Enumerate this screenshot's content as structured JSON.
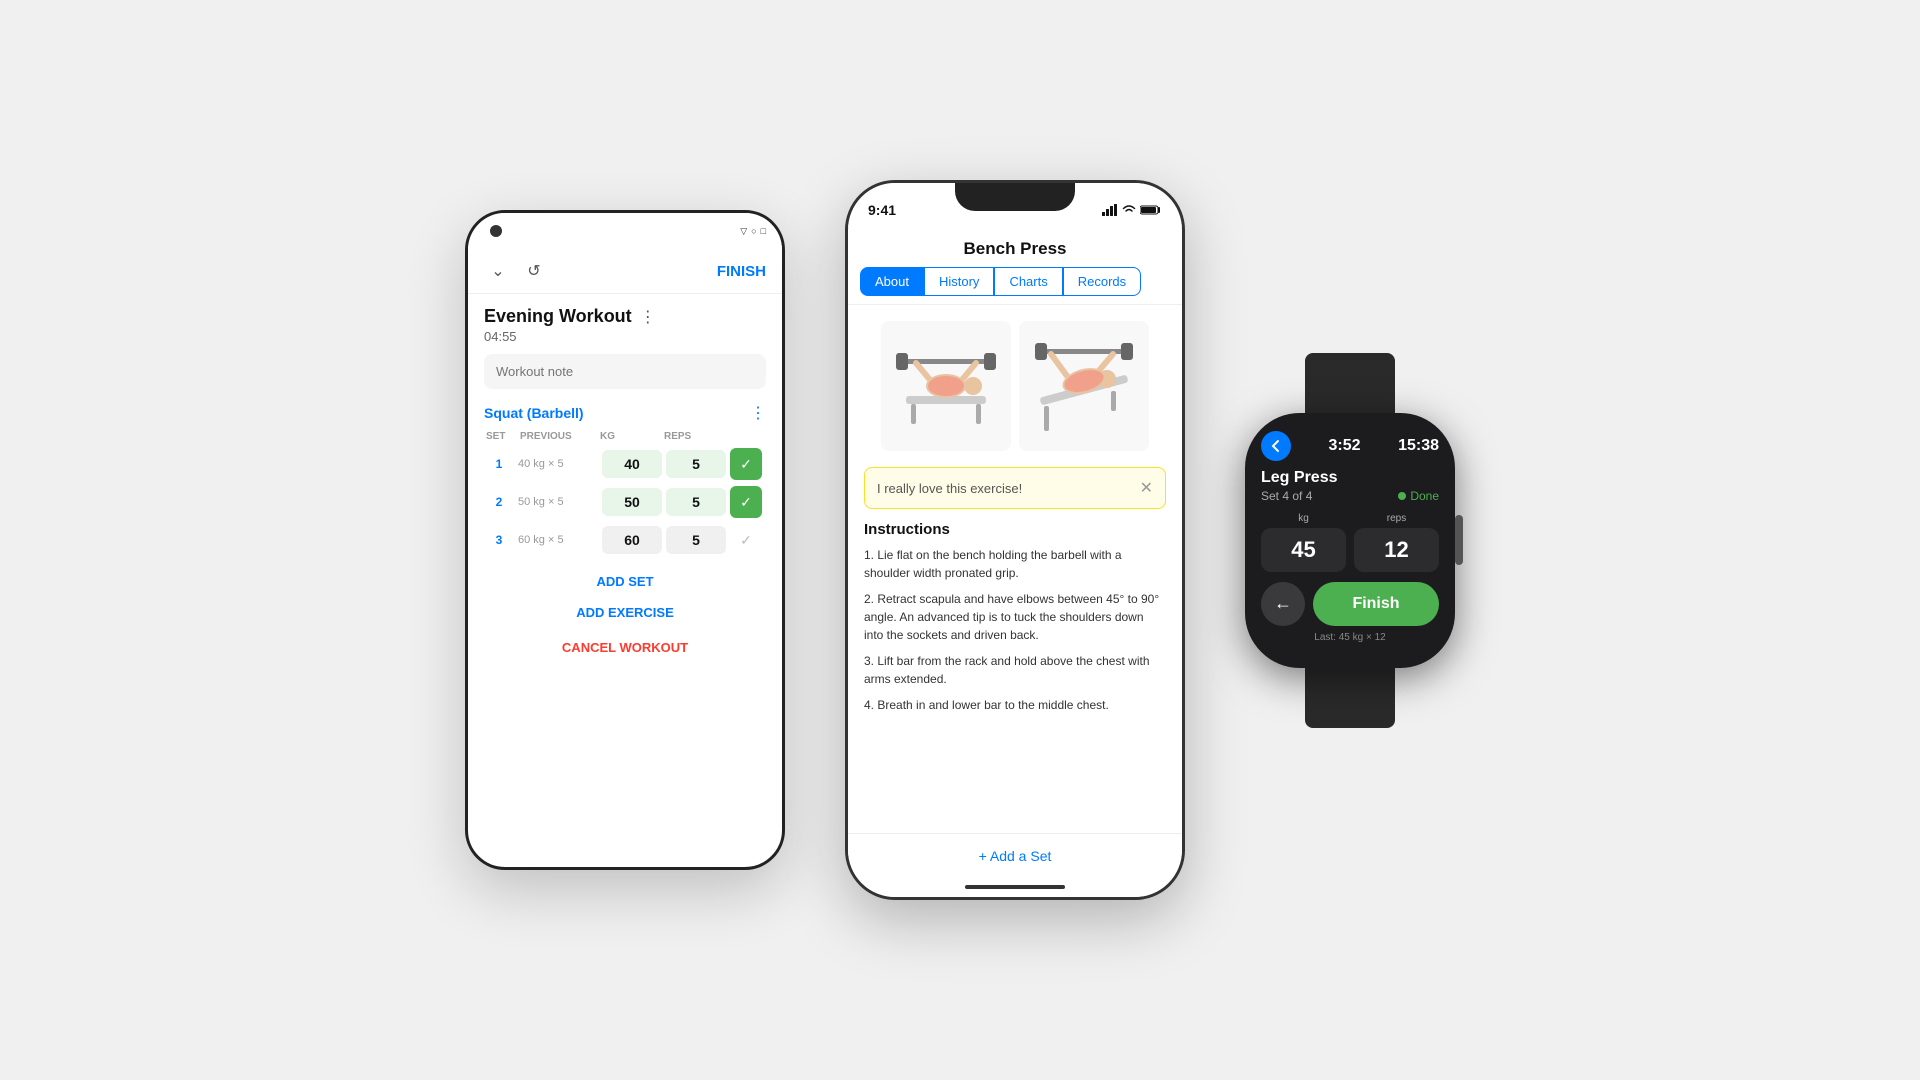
{
  "android": {
    "toolbar": {
      "finish_label": "FINISH"
    },
    "workout": {
      "title": "Evening Workout",
      "timer": "04:55",
      "note_placeholder": "Workout note"
    },
    "exercise": {
      "name": "Squat (Barbell)",
      "sets_header": [
        "SET",
        "PREVIOUS",
        "KG",
        "REPS",
        ""
      ],
      "sets": [
        {
          "num": "1",
          "prev": "40 kg × 5",
          "kg": "40",
          "reps": "5",
          "done": true
        },
        {
          "num": "2",
          "prev": "50 kg × 5",
          "kg": "50",
          "reps": "5",
          "done": true
        },
        {
          "num": "3",
          "prev": "60 kg × 5",
          "kg": "60",
          "reps": "5",
          "done": false
        }
      ]
    },
    "add_set_label": "ADD SET",
    "add_exercise_label": "ADD EXERCISE",
    "cancel_label": "CANCEL WORKOUT"
  },
  "iphone": {
    "status_time": "9:41",
    "exercise_title": "Bench Press",
    "tabs": [
      "About",
      "History",
      "Charts",
      "Records"
    ],
    "active_tab": "About",
    "note": "I really love this exercise!",
    "instructions_title": "Instructions",
    "steps": [
      "1. Lie flat on the bench holding the barbell with a shoulder width pronated grip.",
      "2. Retract scapula and have elbows between 45° to 90° angle. An advanced tip is to tuck the shoulders down into the sockets and driven back.",
      "3. Lift bar from the rack and hold above the chest with arms extended.",
      "4. Breath in and lower bar to the middle chest."
    ],
    "add_set_label": "+ Add a Set"
  },
  "watch": {
    "timer": "3:52",
    "time": "15:38",
    "exercise": "Leg Press",
    "set_info": "Set 4 of 4",
    "done_label": "Done",
    "kg_label": "kg",
    "reps_label": "reps",
    "kg_value": "45",
    "reps_value": "12",
    "back_label": "←",
    "finish_label": "Finish",
    "last_info": "Last: 45 kg × 12"
  },
  "icons": {
    "chevron_down": "⌄",
    "refresh": "↺",
    "three_dots": "⋮",
    "signal": "▲▲▲",
    "wifi": "wifi",
    "battery": "▮",
    "check": "✓",
    "close": "✕",
    "back_arrow": "‹"
  }
}
